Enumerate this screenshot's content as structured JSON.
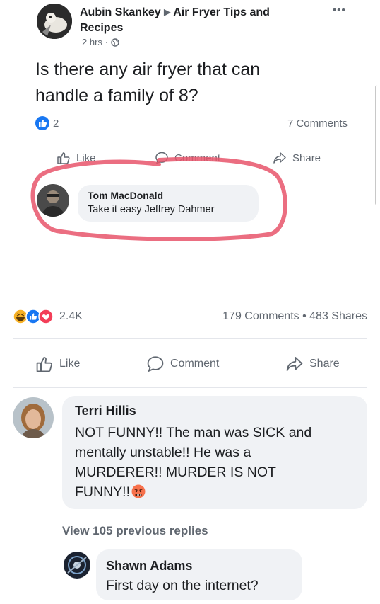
{
  "post": {
    "author": "Aubin Skankey",
    "group": "Air Fryer Tips and",
    "group_line2": "Recipes",
    "time": "2 hrs",
    "more": "•••",
    "text_line1": "Is there any air fryer that can",
    "text_line2": "handle a family of 8?",
    "reaction_count": "2",
    "comments": "7 Comments",
    "like": "Like",
    "comment": "Comment",
    "share": "Share"
  },
  "inner_comment": {
    "author": "Tom MacDonald",
    "text": "Take it easy Jeffrey Dahmer"
  },
  "stats": {
    "reactions": "2.4K",
    "comments": "179 Comments",
    "separator": "•",
    "shares": "483 Shares"
  },
  "actions": {
    "like": "Like",
    "comment": "Comment",
    "share": "Share"
  },
  "comment1": {
    "author": "Terri Hillis",
    "line1": "NOT FUNNY!! The man was SICK and",
    "line2": "mentally unstable!! He was a",
    "line3": "MURDERER!! MURDER IS NOT",
    "line4": "FUNNY!!"
  },
  "view_replies": "View 105 previous replies",
  "comment2": {
    "author": "Shawn Adams",
    "text": "First day on the internet?"
  },
  "colors": {
    "facebook_blue": "#1877f2",
    "highlight_red": "#e8556b",
    "angry_orange": "#f7714c",
    "haha_yellow": "#f7b125"
  }
}
